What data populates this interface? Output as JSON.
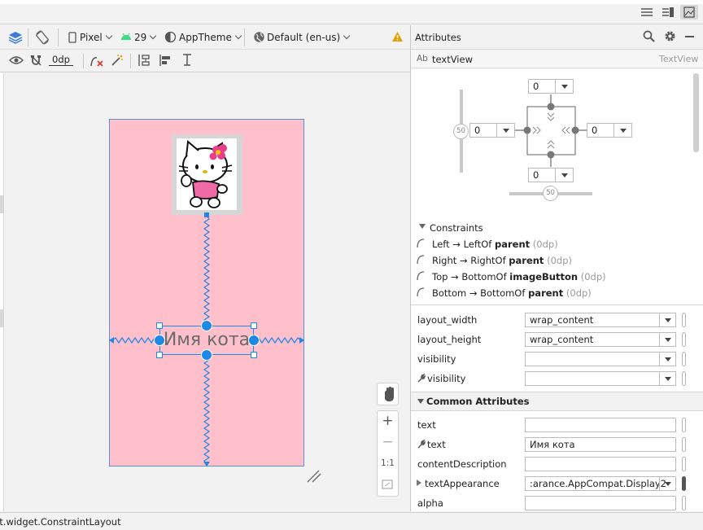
{
  "toolbar": {
    "device": "Pixel",
    "api": "29",
    "theme": "AppTheme",
    "locale": "Default (en-us)",
    "default_margin": "0dp"
  },
  "attributes_panel": {
    "title": "Attributes",
    "component_type_icon": "Ab",
    "component_name": "textView",
    "component_class": "TextView"
  },
  "constraint_widget": {
    "top_margin": "0",
    "left_margin": "0",
    "right_margin": "0",
    "bottom_margin": "0",
    "vertical_bias": "50",
    "horizontal_bias": "50"
  },
  "constraints": {
    "header": "Constraints",
    "items": [
      {
        "pre": "Left → LeftOf ",
        "target": "parent",
        "margin": "(0dp)"
      },
      {
        "pre": "Right → RightOf ",
        "target": "parent",
        "margin": "(0dp)"
      },
      {
        "pre": "Top → BottomOf ",
        "target": "imageButton",
        "margin": "(0dp)"
      },
      {
        "pre": "Bottom → BottomOf ",
        "target": "parent",
        "margin": "(0dp)"
      }
    ]
  },
  "layout_attrs": {
    "layout_width_label": "layout_width",
    "layout_width_value": "wrap_content",
    "layout_height_label": "layout_height",
    "layout_height_value": "wrap_content",
    "visibility_label": "visibility",
    "visibility_value": "",
    "tools_visibility_label": "visibility",
    "tools_visibility_value": ""
  },
  "common_attrs": {
    "header": "Common Attributes",
    "text_label": "text",
    "text_value": "",
    "tools_text_label": "text",
    "tools_text_value": "Имя кота",
    "content_description_label": "contentDescription",
    "content_description_value": "",
    "text_appearance_label": "textAppearance",
    "text_appearance_value": ":arance.AppCompat.Display2",
    "alpha_label": "alpha",
    "alpha_value": ""
  },
  "canvas": {
    "text_view_text": "Имя кота",
    "zoom_reset_label": "1:1"
  },
  "status_bar": {
    "text": "ut.widget.ConstraintLayout"
  },
  "colors": {
    "phone_background": "#ffc0cb",
    "selection_blue": "#1e88e5",
    "panel_background": "#ffffff"
  }
}
